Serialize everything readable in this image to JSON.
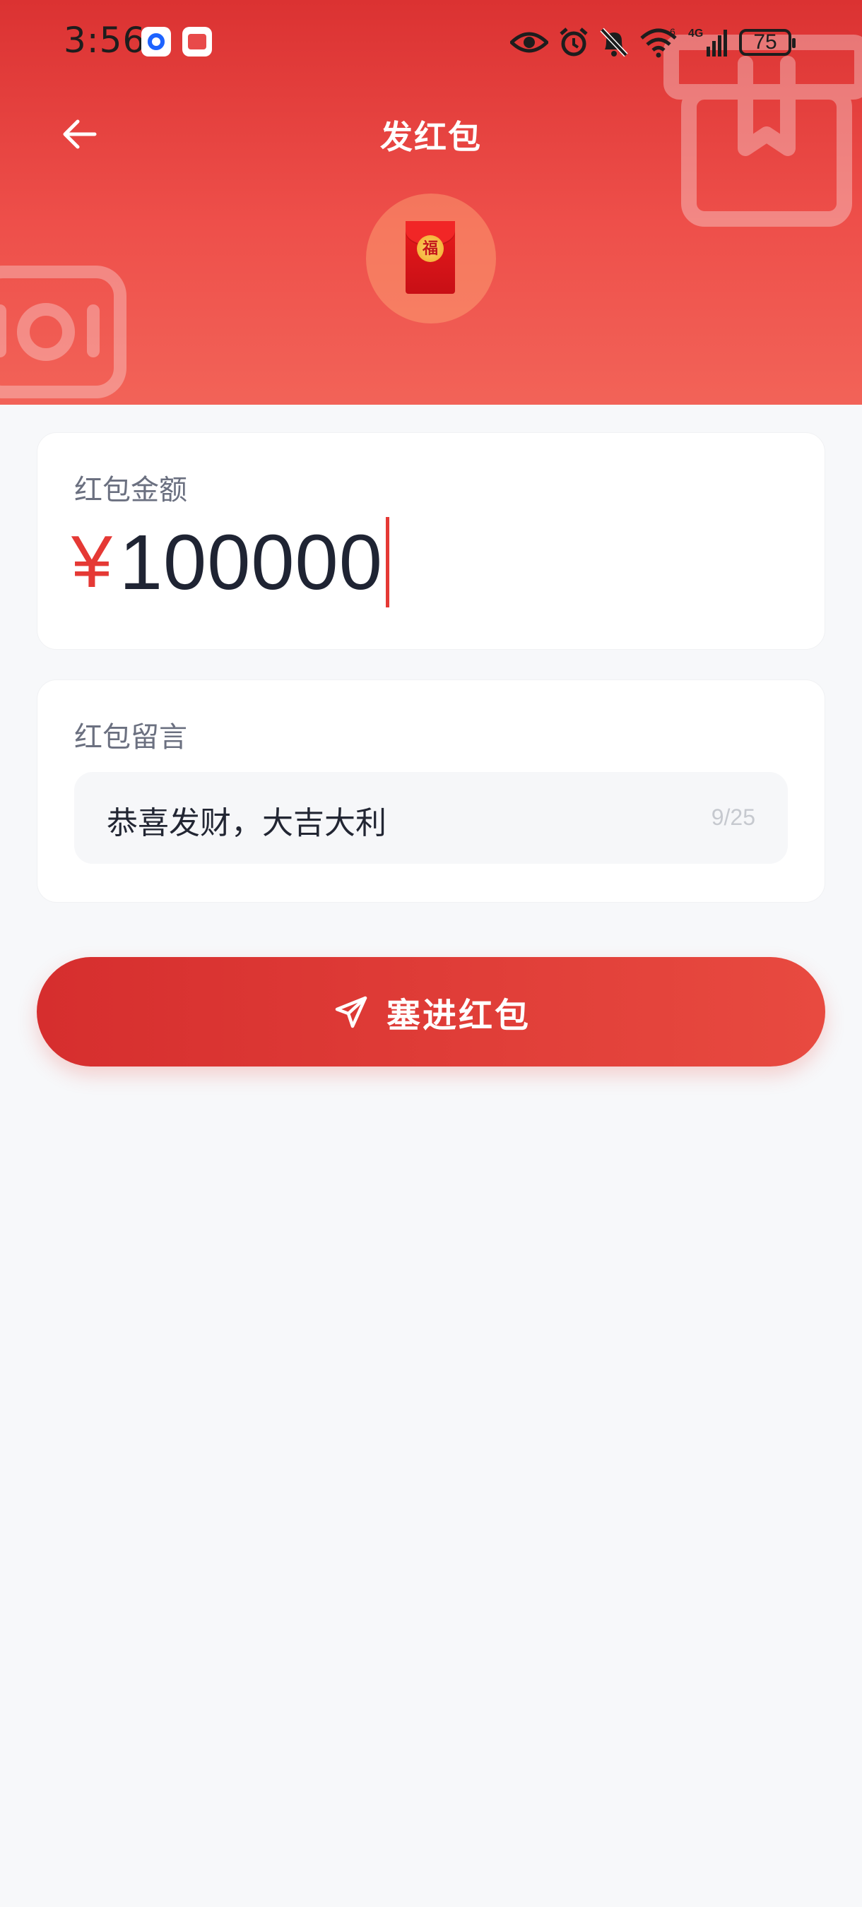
{
  "status_bar": {
    "time": "3:56",
    "battery": "75",
    "network": "4G",
    "sim_slot": "6"
  },
  "header": {
    "title": "发红包",
    "envelope_glyph": "福",
    "colors": {
      "gradient_top": "#db3232",
      "gradient_bottom": "#f26358"
    }
  },
  "amount_card": {
    "label": "红包金额",
    "currency_symbol": "¥",
    "value": "100000"
  },
  "message_card": {
    "label": "红包留言",
    "value": "恭喜发财，大吉大利",
    "char_count": "9/25"
  },
  "submit": {
    "label": "塞进红包",
    "icon": "send-icon"
  },
  "icons": {
    "back": "arrow-left-icon",
    "status": [
      "eye-icon",
      "alarm-icon",
      "mute-bell-icon",
      "wifi-icon",
      "signal-icon",
      "battery-icon"
    ]
  },
  "accent_color": "#e53935"
}
